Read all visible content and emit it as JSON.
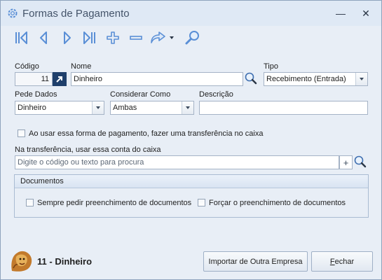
{
  "window": {
    "title": "Formas de Pagamento",
    "minimize_glyph": "—",
    "close_glyph": "✕"
  },
  "toolbar": {
    "icons": [
      "first-record-icon",
      "previous-record-icon",
      "next-record-icon",
      "last-record-icon",
      "add-icon",
      "remove-icon",
      "share-icon",
      "chevron-down-icon",
      "search-icon"
    ]
  },
  "form": {
    "codigo": {
      "label": "Código",
      "value": "11"
    },
    "nome": {
      "label": "Nome",
      "value": "Dinheiro"
    },
    "tipo": {
      "label": "Tipo",
      "value": "Recebimento (Entrada)"
    },
    "pede_dados": {
      "label": "Pede Dados",
      "value": "Dinheiro"
    },
    "considerar_como": {
      "label": "Considerar Como",
      "value": "Ambas"
    },
    "descricao": {
      "label": "Descrição",
      "value": ""
    },
    "transferencia_checkbox": {
      "label": "Ao usar essa forma de pagamento, fazer uma transferência no caixa",
      "checked": false
    },
    "conta_caixa": {
      "label": "Na transferência, usar essa conta do caixa",
      "placeholder": "Digite o código ou texto para procura",
      "add_glyph": "+"
    }
  },
  "documentos": {
    "title": "Documentos",
    "sempre_pedir": {
      "label": "Sempre pedir preenchimento de documentos",
      "checked": false
    },
    "forcar": {
      "label": "Forçar o preenchimento de documentos",
      "checked": false
    }
  },
  "footer": {
    "record_number": "11",
    "record_separator": " - ",
    "record_name": "Dinheiro",
    "import_button": "Importar de Outra Empresa",
    "close_button_first": "F",
    "close_button_rest": "echar"
  },
  "colors": {
    "accent": "#3a7bd5",
    "icon": "#5a8fd6",
    "title_text": "#44546a"
  }
}
